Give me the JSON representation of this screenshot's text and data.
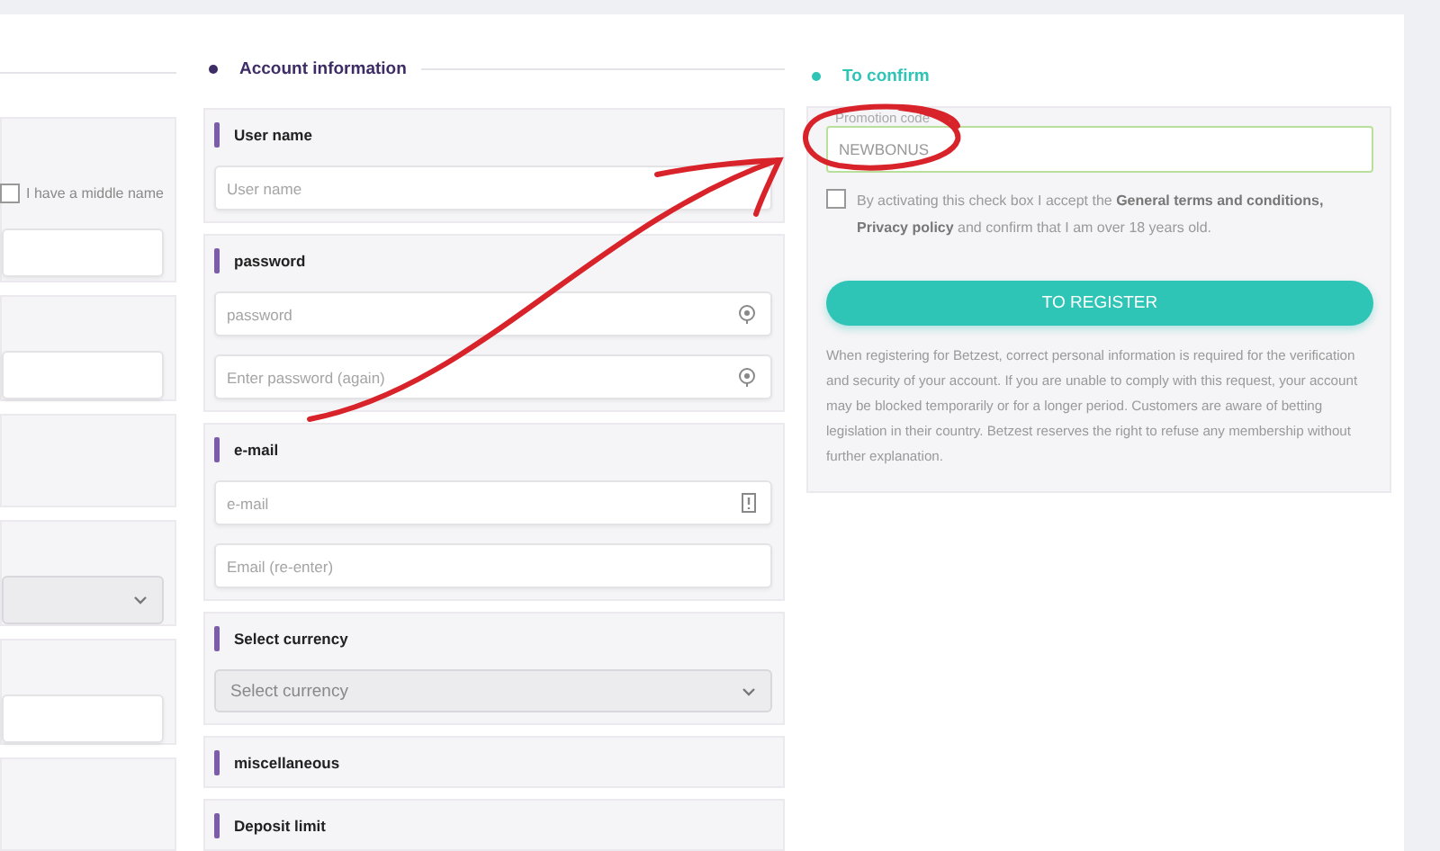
{
  "left_column": {
    "panels": [
      {
        "kind": "checkbox_input",
        "checkbox": {
          "label": "I have a middle name",
          "checked": false
        }
      },
      {
        "kind": "input"
      },
      {
        "kind": "empty"
      },
      {
        "kind": "select"
      },
      {
        "kind": "input"
      },
      {
        "kind": "empty"
      }
    ]
  },
  "account_information": {
    "title": "Account information",
    "panels": [
      {
        "label": "User name",
        "fields": [
          {
            "kind": "plain",
            "placeholder": "User name"
          }
        ]
      },
      {
        "label": "password",
        "fields": [
          {
            "kind": "password",
            "placeholder": "password"
          },
          {
            "kind": "password",
            "placeholder": "Enter password (again)"
          }
        ]
      },
      {
        "label": "e-mail",
        "fields": [
          {
            "kind": "email",
            "placeholder": "e-mail"
          },
          {
            "kind": "plain",
            "placeholder": "Email (re-enter)"
          }
        ]
      },
      {
        "label": "Select currency",
        "fields": [
          {
            "kind": "select",
            "placeholder": "Select currency"
          }
        ]
      },
      {
        "label": "miscellaneous"
      },
      {
        "label": "Deposit limit"
      }
    ]
  },
  "to_confirm": {
    "title": "To confirm",
    "promo": {
      "label": "Promotion code",
      "value": "NEWBONUS"
    },
    "agreement": {
      "text": "By activating this check box I accept the **General terms and conditions, Privacy policy** and confirm that I am over 18 years old.",
      "checked": false
    },
    "register_button": "TO REGISTER",
    "notice": "When registering for Betzest, correct personal information is required for the verification and security of your account. If you are unable to comply with this request, your account may be blocked temporarily or for a longer period. Customers are aware of betting legislation in their country. Betzest reserves the right to refuse any membership without further explanation."
  }
}
